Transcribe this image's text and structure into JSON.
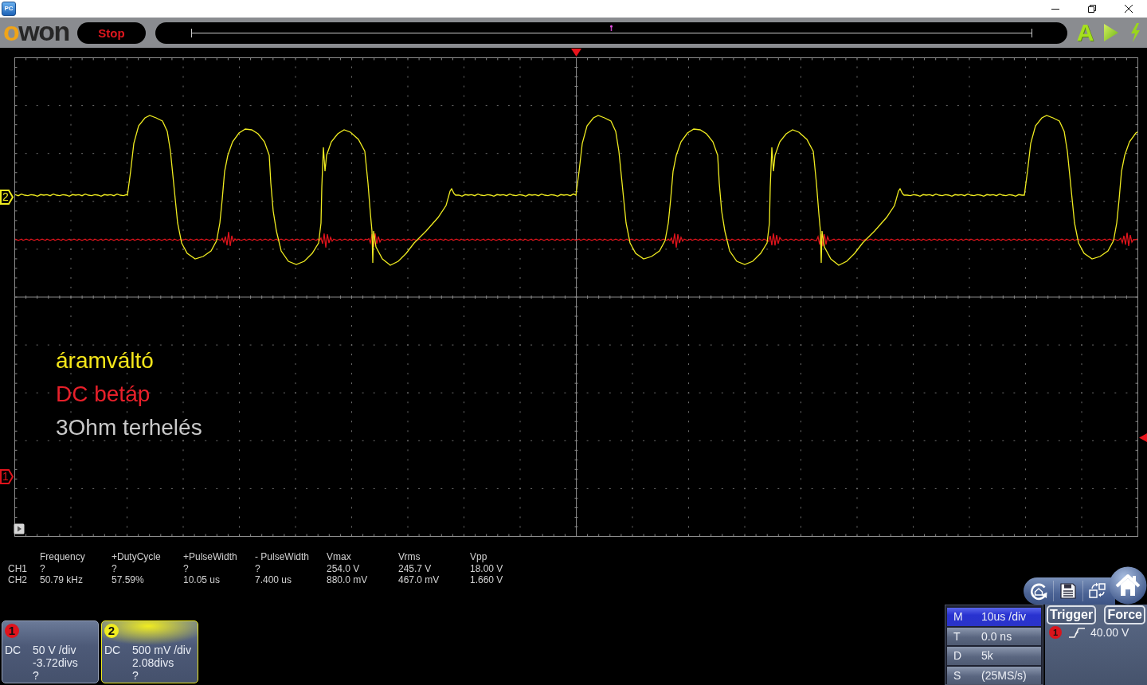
{
  "window": {
    "app_icon": "PC"
  },
  "toolbar": {
    "logo": "owon",
    "run_button": "Stop",
    "auto_button": "A"
  },
  "scope": {
    "channel_markers": [
      {
        "label": "2",
        "color": "#f0ec20"
      },
      {
        "label": "1",
        "color": "#e0141c"
      }
    ],
    "annotations": [
      {
        "text": "áramváltó",
        "color": "#f5e61a"
      },
      {
        "text": "DC betáp",
        "color": "#e8202a"
      },
      {
        "text": "3Ohm terhelés",
        "color": "#c9c9c9"
      }
    ]
  },
  "measurements": {
    "columns": [
      "Frequency",
      "+DutyCycle",
      "+PulseWidth",
      "- PulseWidth",
      "Vmax",
      "Vrms",
      "Vpp"
    ],
    "rows": [
      {
        "channel": "CH1",
        "values": [
          "?",
          "?",
          "?",
          "?",
          "254.0 V",
          "245.7 V",
          "18.00 V"
        ]
      },
      {
        "channel": "CH2",
        "values": [
          "50.79 kHz",
          "57.59%",
          "10.05 us",
          "7.400 us",
          "880.0 mV",
          "467.0 mV",
          "1.660 V"
        ]
      }
    ]
  },
  "channels": [
    {
      "badge": "1",
      "color": "#e0141c",
      "coupling": "DC",
      "scale": "50 V /div",
      "offset": "-3.72divs",
      "probe": "?",
      "selected": false
    },
    {
      "badge": "2",
      "color": "#f0ec20",
      "coupling": "DC",
      "scale": "500 mV /div",
      "offset": "2.08divs",
      "probe": "?",
      "selected": true
    }
  ],
  "timebase": [
    {
      "key": "M",
      "value": "10us /div",
      "selected": true
    },
    {
      "key": "T",
      "value": "0.0 ns",
      "selected": false
    },
    {
      "key": "D",
      "value": "5k",
      "selected": false
    },
    {
      "key": "S",
      "value": "(25MS/s)",
      "selected": false
    }
  ],
  "trigger": {
    "buttons": [
      "Trigger",
      "Force"
    ],
    "source": "1",
    "level": "40.00 V"
  }
}
